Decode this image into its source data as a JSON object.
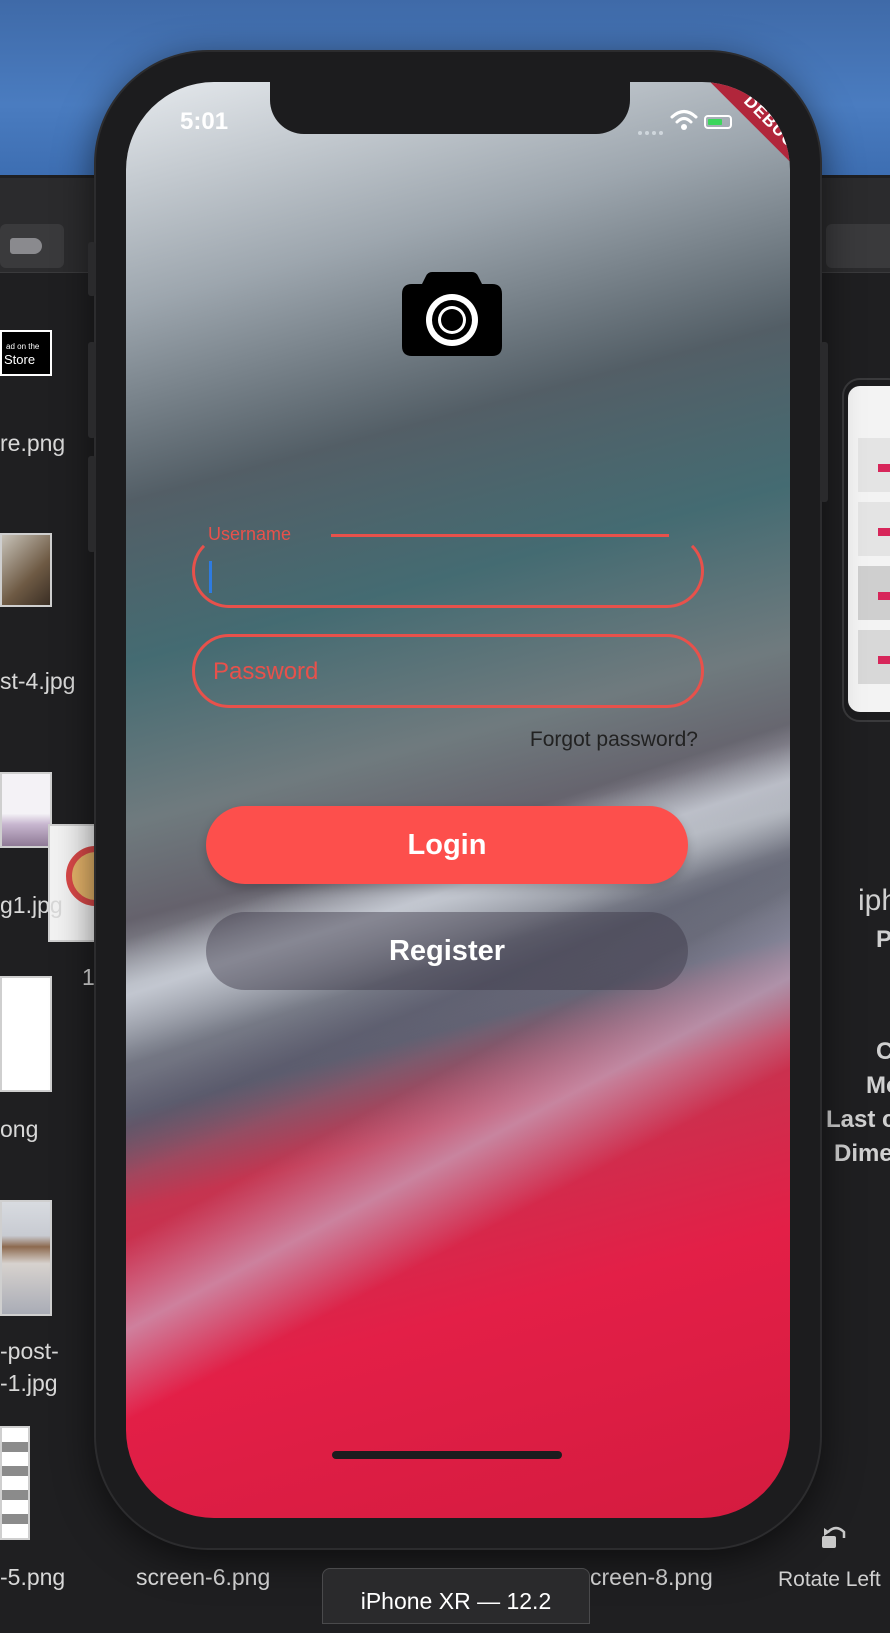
{
  "status_bar": {
    "time": "5:01",
    "debug_banner": "DEBUG"
  },
  "login_form": {
    "username_label": "Username",
    "username_value": "",
    "password_placeholder": "Password",
    "forgot_password": "Forgot password?",
    "login_button": "Login",
    "register_button": "Register"
  },
  "background_files": {
    "appstore_badge_line1": "ad on the",
    "appstore_badge_line2": "Store",
    "left_filenames": [
      "re.png",
      "st-4.jpg",
      "g1.jpg",
      "ong",
      "-post-",
      "-1.jpg",
      "-5.png"
    ],
    "counter_fragment": "1.",
    "bottom_filenames": [
      "screen-6.png",
      "creen-8.png"
    ]
  },
  "simulator": {
    "device_title": "iPhone XR — 12.2",
    "rotate_label": "Rotate Left"
  },
  "info_panel": {
    "fragments": [
      "iph",
      "P",
      "C",
      "Mo",
      "Last c",
      "Dime"
    ]
  },
  "colors": {
    "accent": "#fd4f4c",
    "field_border": "#e8514b",
    "caret": "#2e7be0"
  }
}
